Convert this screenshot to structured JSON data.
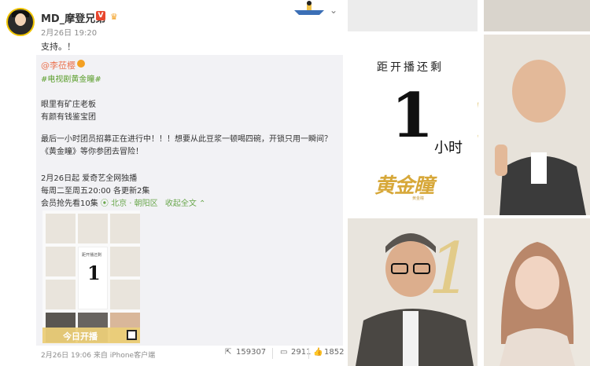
{
  "post": {
    "username": "MD_摩登兄弟",
    "verified_badge": "V",
    "meta": "2月26日 19:20",
    "text": "支持。！"
  },
  "repost": {
    "author": "@李莅樱",
    "hashtag": "#电视剧黄金瞳#",
    "lines": [
      "眼里有矿庄老板",
      "有颜有钱鉴宝团"
    ],
    "promo": "最后一小时团员招募正在进行中！！！想要从此豆浆一顿喝四碗，开锁只用一瞬间？《黄金瞳》等你参团去冒险！",
    "schedule": [
      "2月26日起 爱奇艺全网独播",
      "每周二至周五20:00 各更新2集"
    ],
    "vip_text": "会员抢先看10集",
    "location": "北京 · 朝阳区",
    "expand": "收起全文",
    "thumb": {
      "countdown_label": "距开播还剩",
      "countdown_number": "1",
      "countdown_unit": "小时",
      "banner": "今日开播"
    }
  },
  "footer": {
    "time_source": "2月26日 19:06 来自 iPhone客户端",
    "reposts": "159307",
    "comments": "2911",
    "likes": "1852"
  },
  "poster": {
    "countdown_label": "距开播还剩",
    "countdown_number": "1",
    "countdown_unit": "小时",
    "logo": "黄金瞳",
    "logo_sub": "黄金瞳"
  },
  "icons": [
    "share-icon",
    "comment-icon",
    "like-icon",
    "location-icon",
    "chevron-down-icon"
  ]
}
